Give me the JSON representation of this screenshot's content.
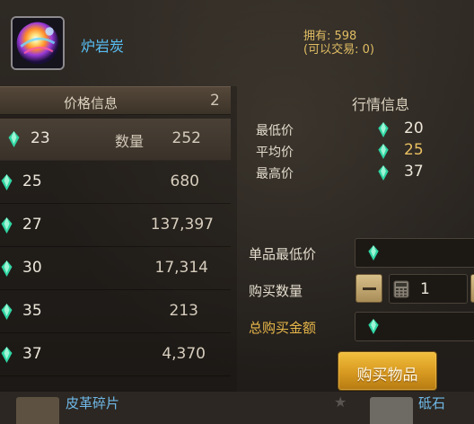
{
  "item": {
    "name": "炉岩炭",
    "owned_line1": "拥有: 598",
    "owned_line2": "(可以交易: 0)",
    "icon": "fire-orb-icon"
  },
  "price_panel": {
    "title": "价格信息",
    "count": "2",
    "qty_label": "数量",
    "rows": [
      {
        "price": "23",
        "qty": "252"
      },
      {
        "price": "25",
        "qty": "680"
      },
      {
        "price": "27",
        "qty": "137,397"
      },
      {
        "price": "30",
        "qty": "17,314"
      },
      {
        "price": "35",
        "qty": "213"
      },
      {
        "price": "37",
        "qty": "4,370"
      }
    ]
  },
  "market": {
    "title": "行情信息",
    "min_label": "最低价",
    "min_value": "20",
    "avg_label": "平均价",
    "avg_value": "25",
    "max_label": "最高价",
    "max_value": "37"
  },
  "form": {
    "unit_min_label": "单品最低价",
    "qty_label": "购买数量",
    "qty_value": "1",
    "total_label": "总购买金额",
    "buy_button": "购买物品"
  },
  "bottom_list": {
    "item1": "皮革碎片",
    "item2": "砥石"
  },
  "colors": {
    "accent_gold": "#e9c061",
    "item_blue": "#58bdf2",
    "button_orange": "#d79920",
    "gem_cyan": "#2fd6a3"
  }
}
